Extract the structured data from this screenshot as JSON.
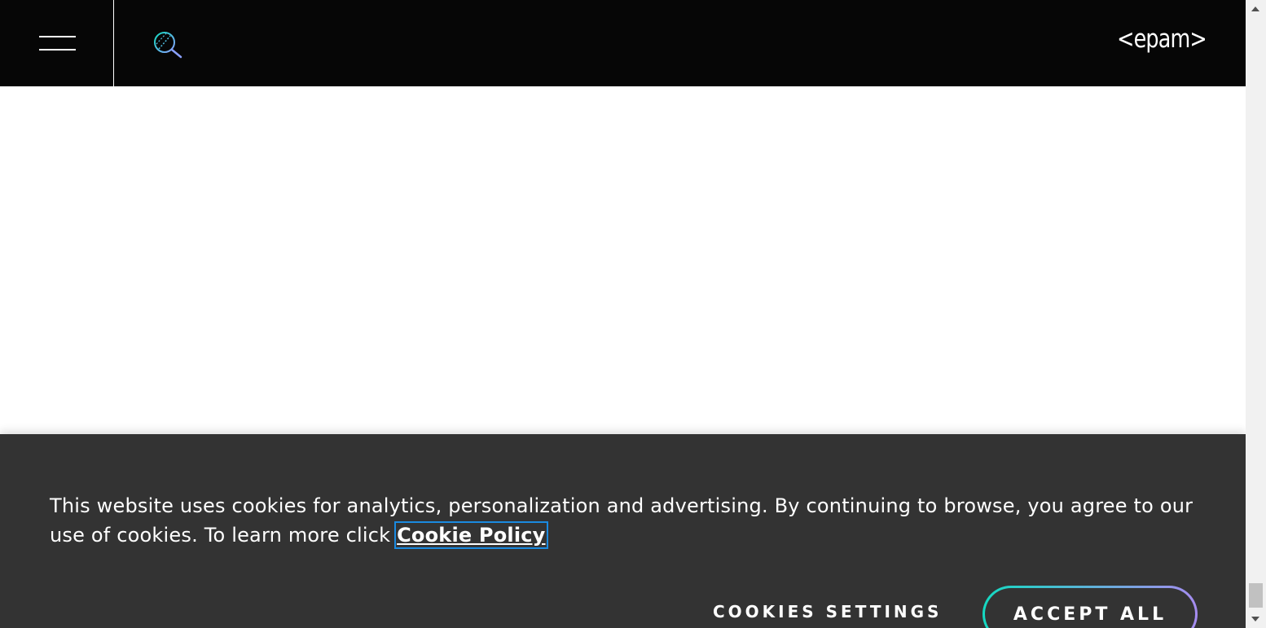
{
  "header": {
    "menu_icon": "hamburger-menu-icon",
    "search_icon": "search-icon",
    "logo_text": "<epam>"
  },
  "cookie_banner": {
    "message": "This website uses cookies for analytics, personalization and advertising. By continuing to browse, you agree to our use of cookies. To learn more click ",
    "link_label": "Cookie Policy",
    "settings_label": "COOKIES SETTINGS",
    "accept_label": "ACCEPT ALL"
  },
  "colors": {
    "header_bg": "#060606",
    "banner_bg": "#333333",
    "accent_teal": "#14d9c1",
    "accent_purple": "#a68cf0",
    "focus_outline": "#1a8ae0"
  }
}
